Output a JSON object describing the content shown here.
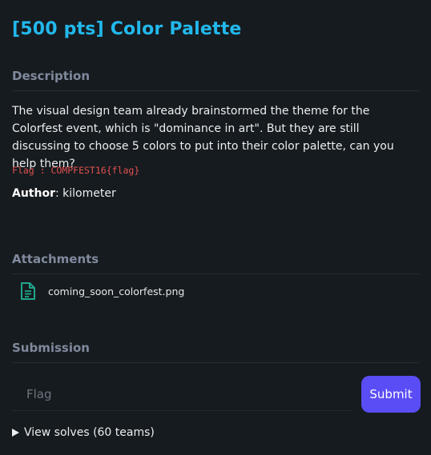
{
  "challenge": {
    "title": "[500 pts] Color Palette"
  },
  "description": {
    "heading": "Description",
    "text": "The visual design team already brainstormed the theme for the Colorfest event, which is \"dominance in art\". But they are still discussing to choose 5 colors to put into their color palette, can you help them?",
    "flag_format": "Flag : COMPFEST16{flag}",
    "author_label": "Author",
    "author_value": ": kilometer"
  },
  "attachments": {
    "heading": "Attachments",
    "items": [
      {
        "name": "coming_soon_colorfest.png",
        "icon": "file-document-icon"
      }
    ]
  },
  "submission": {
    "heading": "Submission",
    "flag_placeholder": "Flag",
    "flag_value": "",
    "submit_label": "Submit"
  },
  "solves": {
    "label": "View solves (60 teams)"
  },
  "colors": {
    "title": "#22b8ec",
    "flag_format": "#e25050",
    "submit": "#5b4df5",
    "attachment_icon": "#1fa58a"
  }
}
